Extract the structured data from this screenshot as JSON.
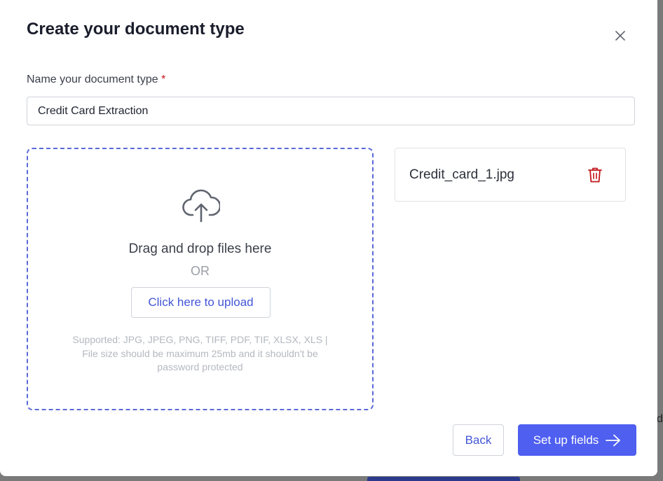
{
  "modal": {
    "title": "Create your document type",
    "close_icon": "close-icon"
  },
  "form": {
    "name_label": "Name your document type",
    "required_mark": "*",
    "name_value": "Credit Card Extraction"
  },
  "dropzone": {
    "icon": "cloud-upload-icon",
    "main_text": "Drag and drop files here",
    "or_text": "OR",
    "upload_button": "Click here to upload",
    "note_line1": "Supported: JPG, JPEG, PNG, TIFF, PDF, TIF, XLSX, XLS |",
    "note_line2": "File size should be maximum 25mb and it shouldn't be",
    "note_line3": "password protected"
  },
  "files": [
    {
      "name": "Credit_card_1.jpg",
      "action_icon": "trash-icon"
    }
  ],
  "footer": {
    "back_label": "Back",
    "next_label": "Set up fields",
    "next_icon": "arrow-right-icon"
  },
  "colors": {
    "accent": "#4f5ff0",
    "link": "#4356d6",
    "dashed_border": "#5a6ad8",
    "danger": "#c4161c"
  }
}
